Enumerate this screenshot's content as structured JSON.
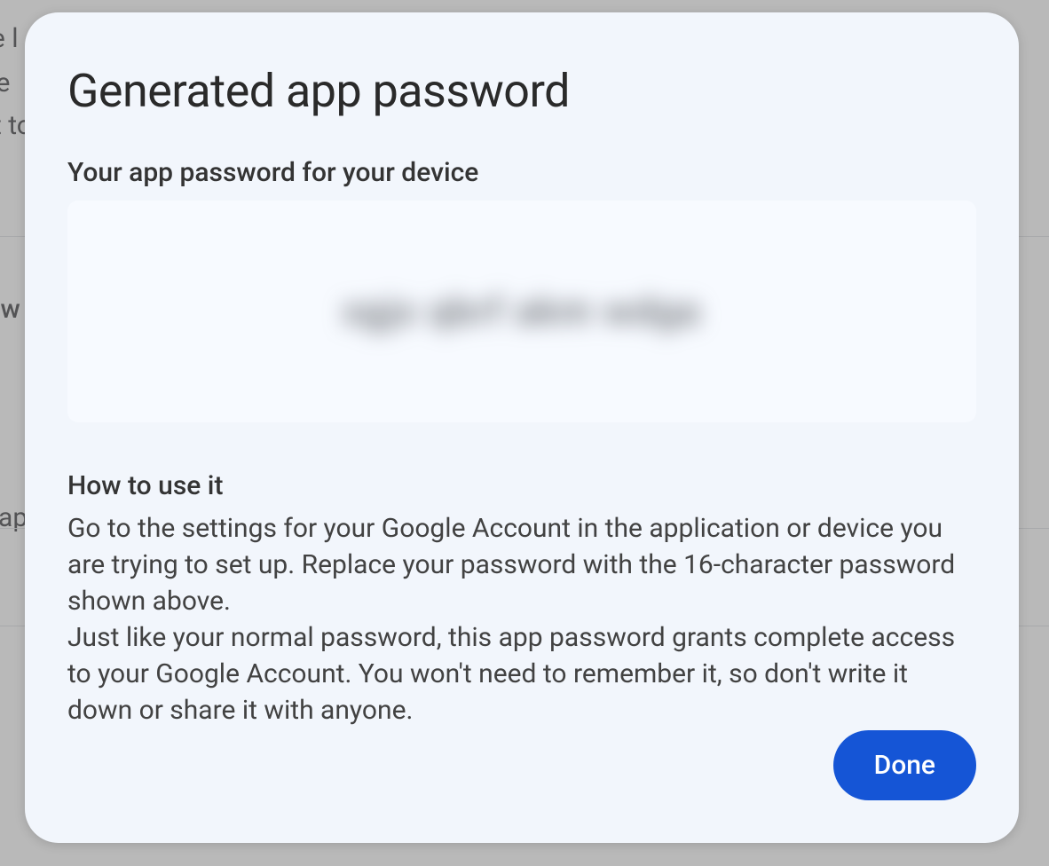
{
  "background": {
    "line1": "re l",
    "line2": "se",
    "line3": "t to",
    "line4": "sw",
    "line5": "ap"
  },
  "dialog": {
    "title": "Generated app password",
    "password_label": "Your app password for your device",
    "password_value": "xgjx qbrf akm wdga",
    "howto_title": "How to use it",
    "howto_body": "Go to the settings for your Google Account in the application or device you are trying to set up. Replace your password with the 16-character password shown above.\nJust like your normal password, this app password grants complete access to your Google Account. You won't need to remember it, so don't write it down or share it with anyone.",
    "done_label": "Done"
  }
}
